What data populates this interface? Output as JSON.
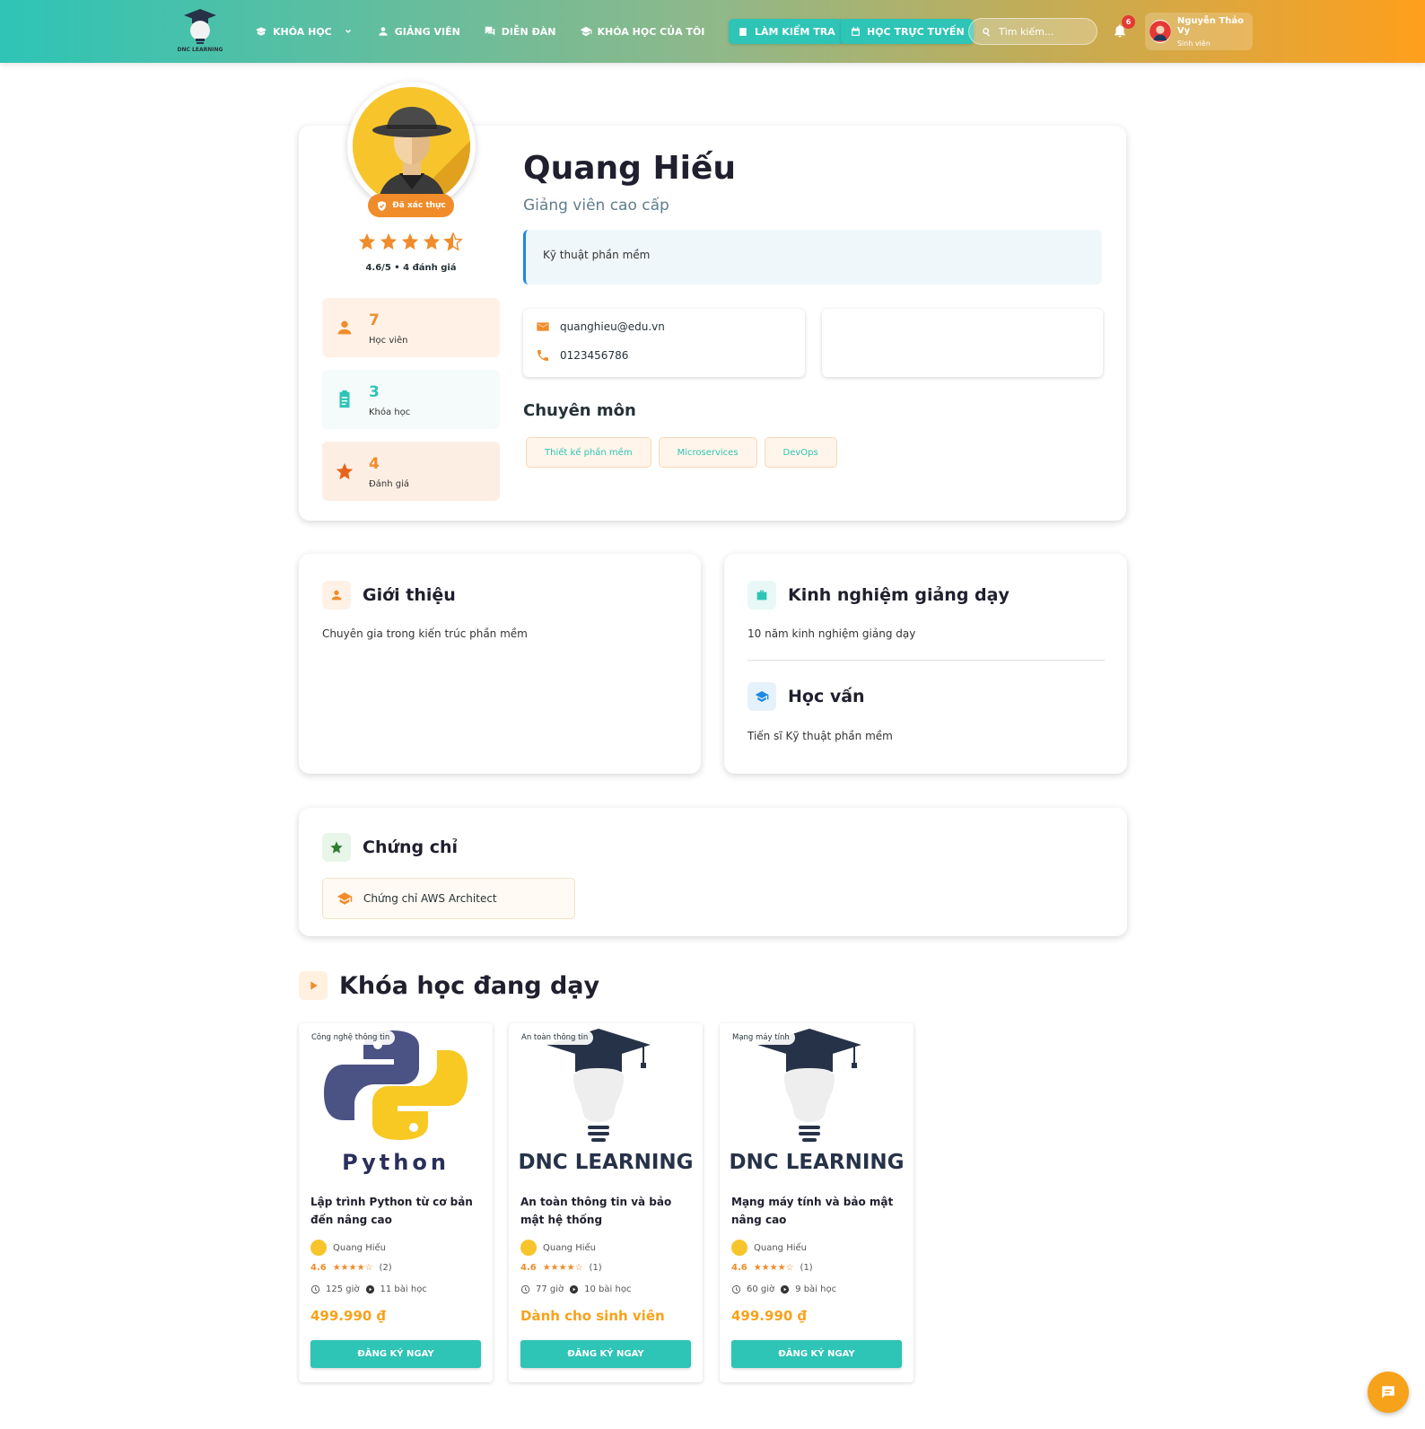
{
  "brand": {
    "logo_text": "DNC LEARNING"
  },
  "nav": {
    "items": [
      {
        "label": "KHÓA HỌC",
        "icon": "book-open-icon"
      },
      {
        "label": "GIẢNG VIÊN",
        "icon": "person-icon"
      },
      {
        "label": "DIỄN ĐÀN",
        "icon": "forum-icon"
      },
      {
        "label": "KHÓA HỌC CỦA TÔI",
        "icon": "graduation-cap-icon"
      }
    ],
    "quiz_button": "LÀM KIỂM TRA",
    "online_button": "HỌC TRỰC TUYẾN",
    "search_placeholder": "Tìm kiếm...",
    "notification_count": "6",
    "user": {
      "name": "Nguyễn Thảo Vy",
      "role": "Sinh viên"
    }
  },
  "colors": {
    "primary": "#2ec4b6",
    "accent": "#f08c2a",
    "price": "#f7a21b"
  },
  "profile": {
    "verified_label": "Đã xác thực",
    "rating": 4.6,
    "rating_text": "4.6/5 • 4 đánh giá",
    "stats": [
      {
        "value": "7",
        "label": "Học viên",
        "icon": "person-icon"
      },
      {
        "value": "3",
        "label": "Khóa học",
        "icon": "clipboard-icon"
      },
      {
        "value": "4",
        "label": "Đánh giá",
        "icon": "star-icon"
      }
    ],
    "name": "Quang Hiếu",
    "title": "Giảng viên cao cấp",
    "department": "Kỹ thuật phần mềm",
    "email": "quanghieu@edu.vn",
    "phone": "0123456786",
    "specialty_title": "Chuyên môn",
    "specialties": [
      "Thiết kế phần mềm",
      "Microservices",
      "DevOps"
    ]
  },
  "intro": {
    "title": "Giới thiệu",
    "text": "Chuyên gia trong kiến trúc phần mềm"
  },
  "experience": {
    "title": "Kinh nghiệm giảng dạy",
    "text": "10 năm kinh nghiệm giảng dạy"
  },
  "education": {
    "title": "Học vấn",
    "text": "Tiến sĩ Kỹ thuật phần mềm"
  },
  "certificates": {
    "title": "Chứng chỉ",
    "items": [
      "Chứng chỉ AWS Architect"
    ]
  },
  "courses": {
    "title": "Khóa học đang dạy",
    "items": [
      {
        "category": "Công nghệ thông tin",
        "image_text": "Python",
        "title": "Lập trình Python từ cơ bản đến nâng cao",
        "instructor": "Quang Hiếu",
        "rating": "4.6",
        "stars": "★★★★☆",
        "reviews": "(2)",
        "hours": "125 giờ",
        "lessons": "11 bài học",
        "price": "499.990 ₫",
        "button": "ĐĂNG KÝ NGAY"
      },
      {
        "category": "An toàn thông tin",
        "image_text": "DNC LEARNING",
        "title": "An toàn thông tin và bảo mật hệ thống",
        "instructor": "Quang Hiếu",
        "rating": "4.6",
        "stars": "★★★★☆",
        "reviews": "(1)",
        "hours": "77 giờ",
        "lessons": "10 bài học",
        "price": "Dành cho sinh viên",
        "button": "ĐĂNG KÝ NGAY"
      },
      {
        "category": "Mạng máy tính",
        "image_text": "DNC LEARNING",
        "title": "Mạng máy tính và bảo mật nâng cao",
        "instructor": "Quang Hiếu",
        "rating": "4.6",
        "stars": "★★★★☆",
        "reviews": "(1)",
        "hours": "60 giờ",
        "lessons": "9 bài học",
        "price": "499.990 ₫",
        "button": "ĐĂNG KÝ NGAY"
      }
    ]
  }
}
